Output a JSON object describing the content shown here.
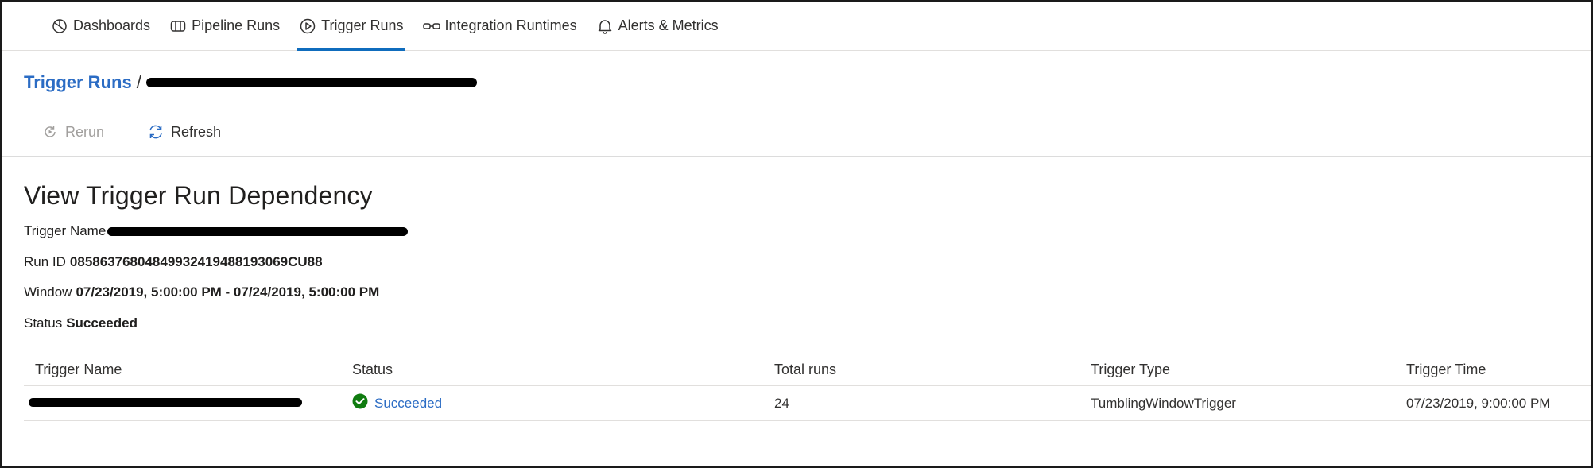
{
  "nav": {
    "items": [
      {
        "label": "Dashboards",
        "icon": "dashboards-icon"
      },
      {
        "label": "Pipeline Runs",
        "icon": "pipeline-icon"
      },
      {
        "label": "Trigger Runs",
        "icon": "trigger-runs-icon"
      },
      {
        "label": "Integration Runtimes",
        "icon": "integration-runtimes-icon"
      },
      {
        "label": "Alerts & Metrics",
        "icon": "bell-icon"
      }
    ],
    "active": "Trigger Runs"
  },
  "breadcrumb": {
    "root": "Trigger Runs",
    "separator": "/"
  },
  "toolbar": {
    "rerun_label": "Rerun",
    "refresh_label": "Refresh"
  },
  "details": {
    "title": "View Trigger Run Dependency",
    "trigger_name_label": "Trigger Name",
    "run_id_label": "Run ID",
    "run_id_value": "08586376804849932419488193069CU88",
    "window_label": "Window",
    "window_value": "07/23/2019, 5:00:00 PM - 07/24/2019, 5:00:00 PM",
    "status_label": "Status",
    "status_value": "Succeeded"
  },
  "table": {
    "columns": [
      "Trigger Name",
      "Status",
      "Total runs",
      "Trigger Type",
      "Trigger Time"
    ],
    "rows": [
      {
        "status": "Succeeded",
        "total_runs": "24",
        "trigger_type": "TumblingWindowTrigger",
        "trigger_time": "07/23/2019, 9:00:00 PM"
      }
    ]
  },
  "colors": {
    "link": "#2b6cc4",
    "accent": "#0f6cbd",
    "success": "#107c10",
    "disabled": "#a19f9d"
  }
}
